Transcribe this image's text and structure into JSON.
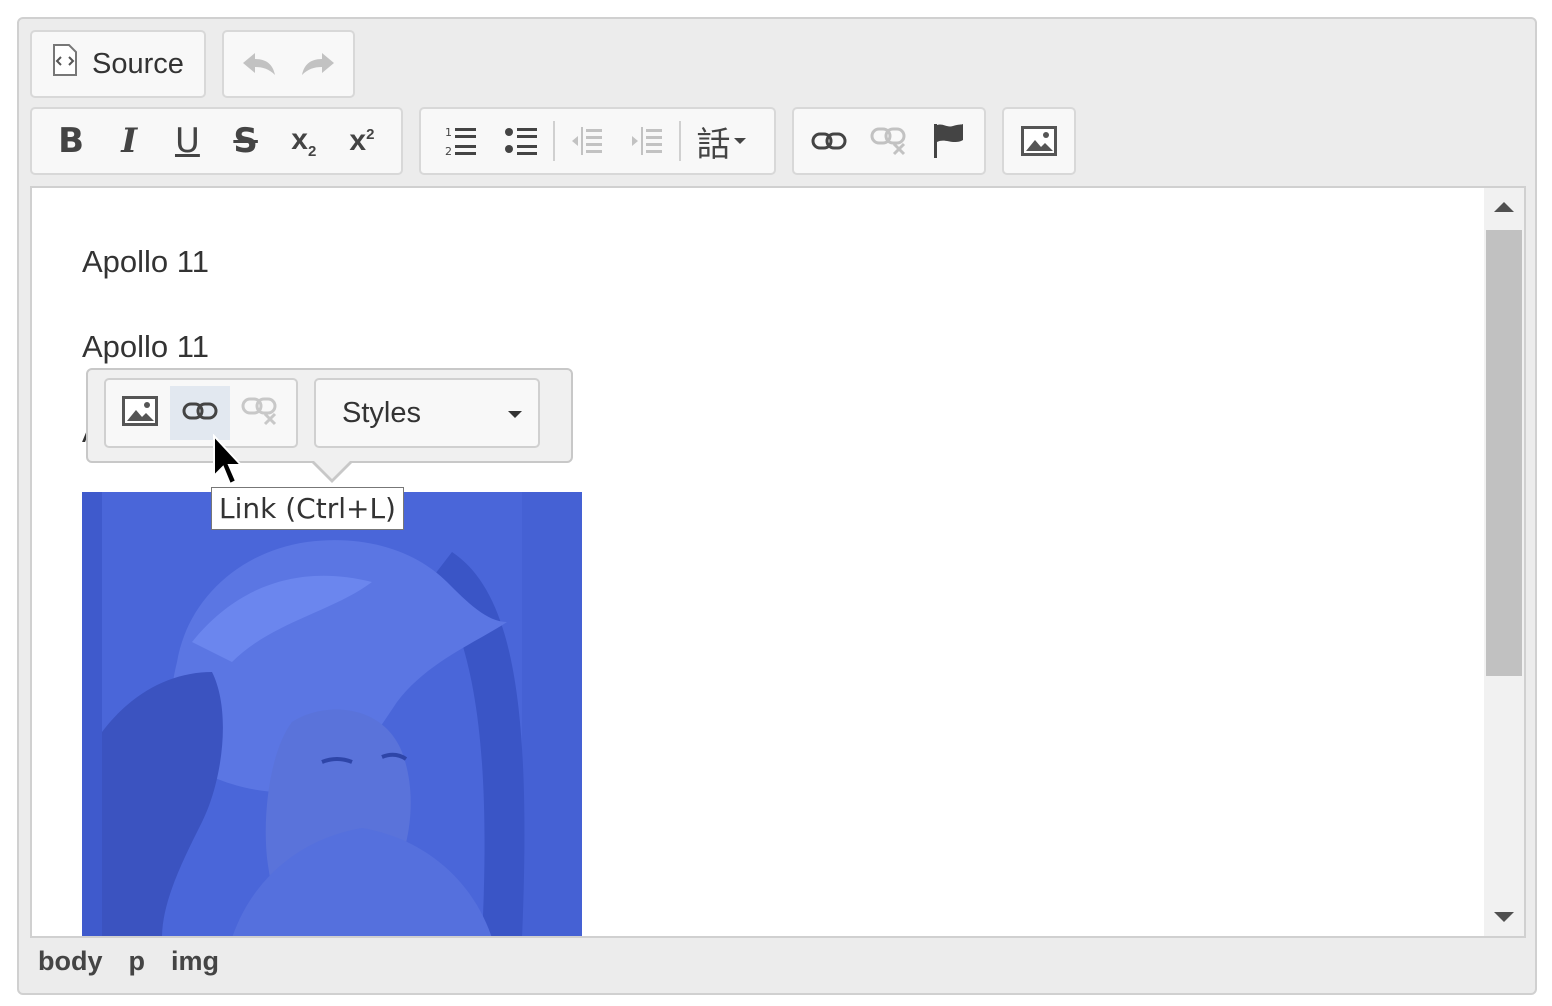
{
  "toolbar": {
    "source_label": "Source",
    "row1_icons": [
      "undo-icon",
      "redo-icon"
    ],
    "row2_basicstyles": [
      "bold-icon",
      "italic-icon",
      "underline-icon",
      "strike-icon",
      "subscript-icon",
      "superscript-icon"
    ],
    "row2_list": [
      "numbered-list-icon",
      "bulleted-list-icon",
      "outdent-icon",
      "indent-icon",
      "language-icon"
    ],
    "row2_links": [
      "link-icon",
      "unlink-icon",
      "anchor-icon"
    ],
    "row2_insert": [
      "image-icon"
    ],
    "language_glyph": "話"
  },
  "content": {
    "paragraphs": [
      "Apollo 11",
      "Apollo 11",
      "A"
    ]
  },
  "balloon": {
    "styles_label": "Styles",
    "buttons": [
      "image-icon",
      "link-icon",
      "unlink-icon"
    ]
  },
  "tooltip": {
    "text": "Link (Ctrl+L)"
  },
  "elements_path": [
    "body",
    "p",
    "img"
  ],
  "colors": {
    "image_tint": "#4a66d9",
    "hover_bg": "#e2e8f0"
  }
}
